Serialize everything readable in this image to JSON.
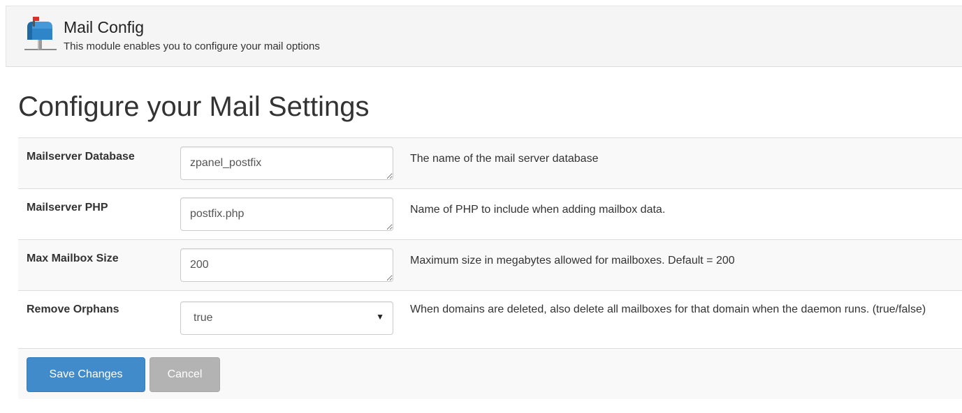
{
  "module": {
    "title": "Mail Config",
    "description": "This module enables you to configure your mail options",
    "icon": "mailbox-icon"
  },
  "page": {
    "title": "Configure your Mail Settings"
  },
  "settings": [
    {
      "label": "Mailserver Database",
      "value": "zpanel_postfix",
      "type": "textarea",
      "help": "The name of the mail server database"
    },
    {
      "label": "Mailserver PHP",
      "value": "postfix.php",
      "type": "textarea",
      "help": "Name of PHP to include when adding mailbox data."
    },
    {
      "label": "Max Mailbox Size",
      "value": "200",
      "type": "textarea",
      "help": "Maximum size in megabytes allowed for mailboxes. Default = 200"
    },
    {
      "label": "Remove Orphans",
      "value": "true",
      "type": "select",
      "help": "When domains are deleted, also delete all mailboxes for that domain when the daemon runs. (true/false)"
    }
  ],
  "actions": {
    "save_label": "Save Changes",
    "cancel_label": "Cancel"
  },
  "colors": {
    "primary": "#428bca",
    "cancel": "#b3b3b3",
    "header_bg": "#f5f5f5",
    "row_stripe": "#f9f9f9"
  }
}
